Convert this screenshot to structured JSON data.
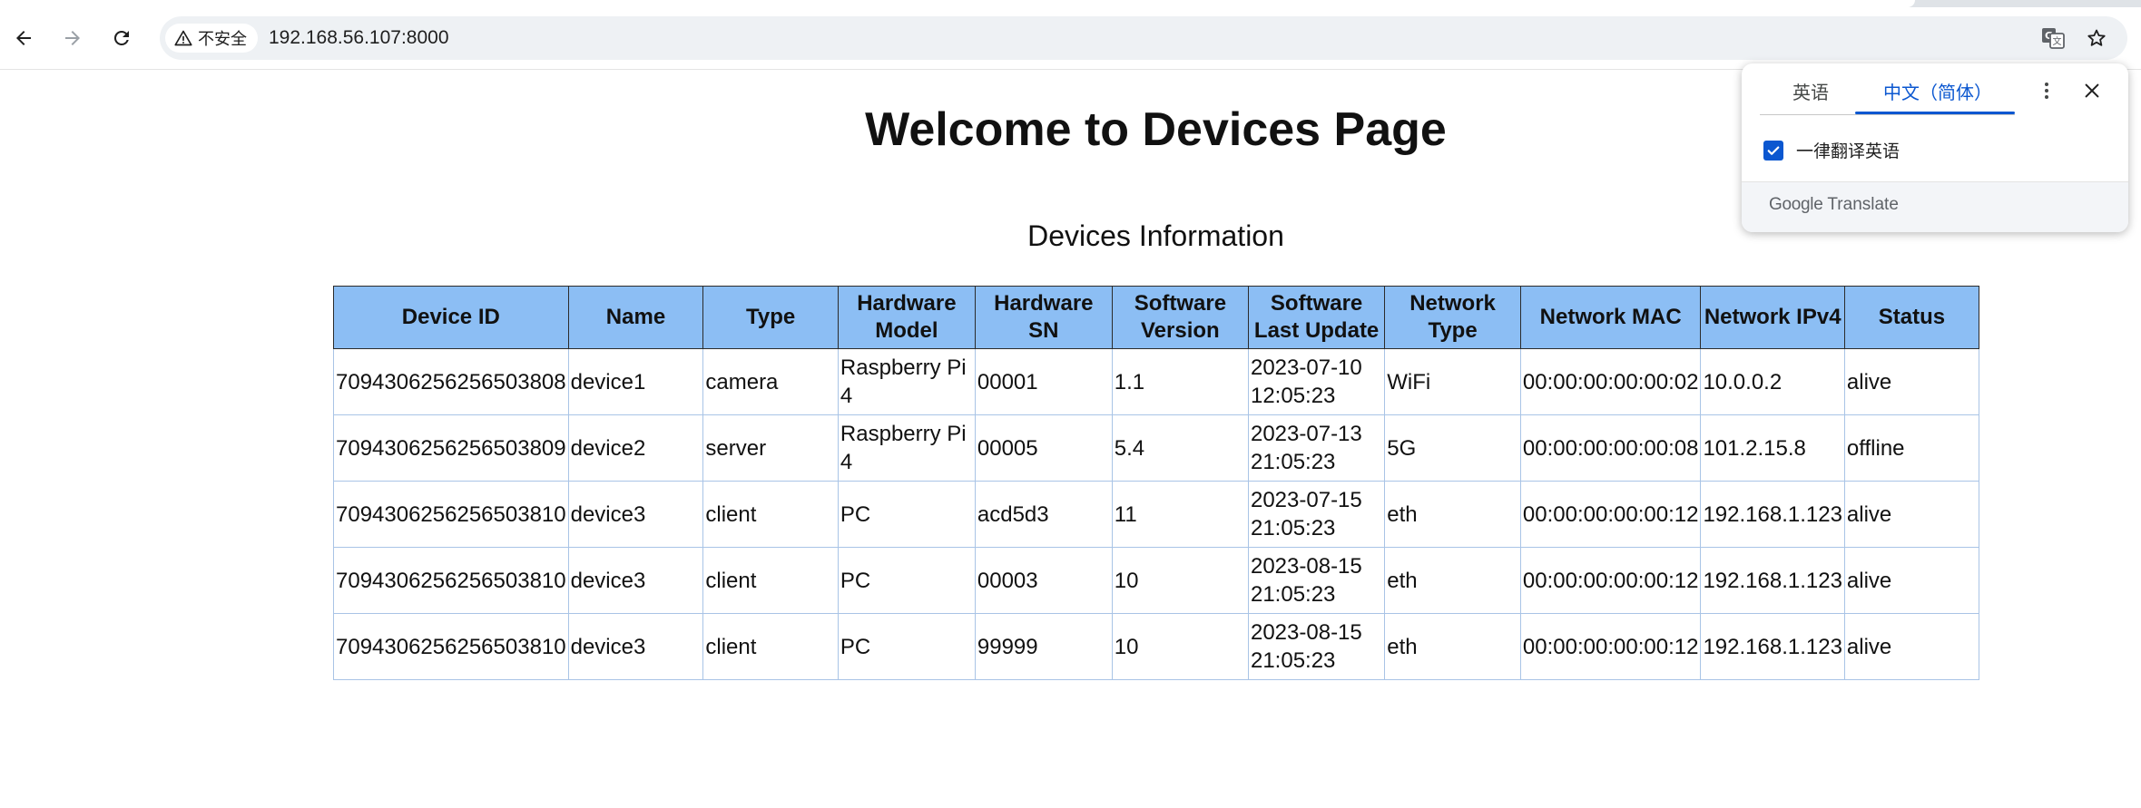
{
  "browser": {
    "security_label": "不安全",
    "url": "192.168.56.107:8000"
  },
  "page": {
    "title": "Welcome to Devices Page",
    "section_title": "Devices Information"
  },
  "table": {
    "headers": [
      "Device ID",
      "Name",
      "Type",
      "Hardware Model",
      "Hardware SN",
      "Software Version",
      "Software Last Update",
      "Network Type",
      "Network MAC",
      "Network IPv4",
      "Status"
    ],
    "rows": [
      [
        "7094306256256503808",
        "device1",
        "camera",
        "Raspberry Pi 4",
        "00001",
        "1.1",
        "2023-07-10 12:05:23",
        "WiFi",
        "00:00:00:00:00:02",
        "10.0.0.2",
        "alive"
      ],
      [
        "7094306256256503809",
        "device2",
        "server",
        "Raspberry Pi 4",
        "00005",
        "5.4",
        "2023-07-13 21:05:23",
        "5G",
        "00:00:00:00:00:08",
        "101.2.15.8",
        "offline"
      ],
      [
        "7094306256256503810",
        "device3",
        "client",
        "PC",
        "acd5d3",
        "11",
        "2023-07-15 21:05:23",
        "eth",
        "00:00:00:00:00:12",
        "192.168.1.123",
        "alive"
      ],
      [
        "7094306256256503810",
        "device3",
        "client",
        "PC",
        "00003",
        "10",
        "2023-08-15 21:05:23",
        "eth",
        "00:00:00:00:00:12",
        "192.168.1.123",
        "alive"
      ],
      [
        "7094306256256503810",
        "device3",
        "client",
        "PC",
        "99999",
        "10",
        "2023-08-15 21:05:23",
        "eth",
        "00:00:00:00:00:12",
        "192.168.1.123",
        "alive"
      ]
    ]
  },
  "translate_popup": {
    "tab_source": "英语",
    "tab_target": "中文（简体）",
    "always_translate_label": "一律翻译英语",
    "always_translate_checked": true,
    "footer_google": "Google",
    "footer_translate": "Translate"
  },
  "icons": {
    "back": "arrow-left-icon",
    "forward": "arrow-right-icon",
    "reload": "reload-icon",
    "warning": "warning-triangle-icon",
    "translate": "translate-icon",
    "bookmark": "star-icon",
    "menu": "more-vert-icon",
    "close": "close-icon",
    "check": "check-icon"
  },
  "colors": {
    "header_bg": "#8cbef4",
    "accent": "#0b57d0"
  }
}
